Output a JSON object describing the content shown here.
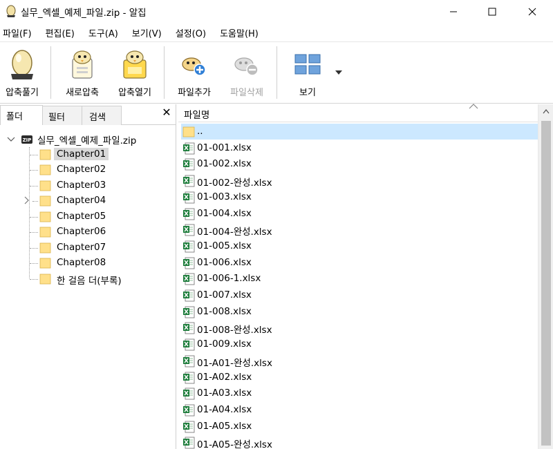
{
  "window": {
    "title": "실무_엑셀_예제_파일.zip - 알집"
  },
  "menu": [
    {
      "label": "파일(F)"
    },
    {
      "label": "편집(E)"
    },
    {
      "label": "도구(A)"
    },
    {
      "label": "보기(V)"
    },
    {
      "label": "설정(O)"
    },
    {
      "label": "도움말(H)"
    }
  ],
  "toolbar": {
    "extract_label": "압축풀기",
    "new_label": "새로압축",
    "open_label": "압축열기",
    "add_label": "파일추가",
    "delete_label": "파일삭제",
    "view_label": "보기"
  },
  "left_panel": {
    "tabs": [
      {
        "label": "폴더"
      },
      {
        "label": "필터"
      },
      {
        "label": "검색"
      }
    ],
    "close_glyph": "✕",
    "root_label": "실무_엑셀_예제_파일.zip",
    "folders": [
      {
        "label": "Chapter01"
      },
      {
        "label": "Chapter02"
      },
      {
        "label": "Chapter03"
      },
      {
        "label": "Chapter04"
      },
      {
        "label": "Chapter05"
      },
      {
        "label": "Chapter06"
      },
      {
        "label": "Chapter07"
      },
      {
        "label": "Chapter08"
      },
      {
        "label": "한 걸음 더(부록)"
      }
    ]
  },
  "file_list": {
    "column_header": "파일명",
    "parent_label": "..",
    "files": [
      {
        "name": "01-001.xlsx"
      },
      {
        "name": "01-002.xlsx"
      },
      {
        "name": "01-002-완성.xlsx"
      },
      {
        "name": "01-003.xlsx"
      },
      {
        "name": "01-004.xlsx"
      },
      {
        "name": "01-004-완성.xlsx"
      },
      {
        "name": "01-005.xlsx"
      },
      {
        "name": "01-006.xlsx"
      },
      {
        "name": "01-006-1.xlsx"
      },
      {
        "name": "01-007.xlsx"
      },
      {
        "name": "01-008.xlsx"
      },
      {
        "name": "01-008-완성.xlsx"
      },
      {
        "name": "01-009.xlsx"
      },
      {
        "name": "01-A01-완성.xlsx"
      },
      {
        "name": "01-A02.xlsx"
      },
      {
        "name": "01-A03.xlsx"
      },
      {
        "name": "01-A04.xlsx"
      },
      {
        "name": "01-A05.xlsx"
      },
      {
        "name": "01-A05-완성.xlsx"
      }
    ]
  },
  "colors": {
    "selection": "#cce8ff",
    "folder": "#ffd966",
    "excel_green": "#1e7d3c"
  }
}
